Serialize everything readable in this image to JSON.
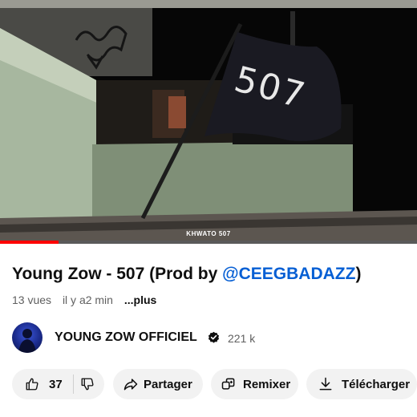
{
  "video": {
    "caption": "KHWATO 507",
    "flag_text": "507",
    "progress": 0.14
  },
  "title": {
    "main": "Young Zow - 507 (Prod by ",
    "link": "@CEEGBADAZZ",
    "close": ")"
  },
  "meta": {
    "views": "13 vues",
    "time": "il y a2 min",
    "more": "...plus"
  },
  "channel": {
    "name": "YOUNG ZOW OFFICIEL",
    "subscribers": "221 k"
  },
  "actions": {
    "like_count": "37",
    "share_label": "Partager",
    "remix_label": "Remixer",
    "download_label": "Télécharger"
  },
  "colors": {
    "accent_link": "#065fd4",
    "progress": "#ff0000"
  }
}
